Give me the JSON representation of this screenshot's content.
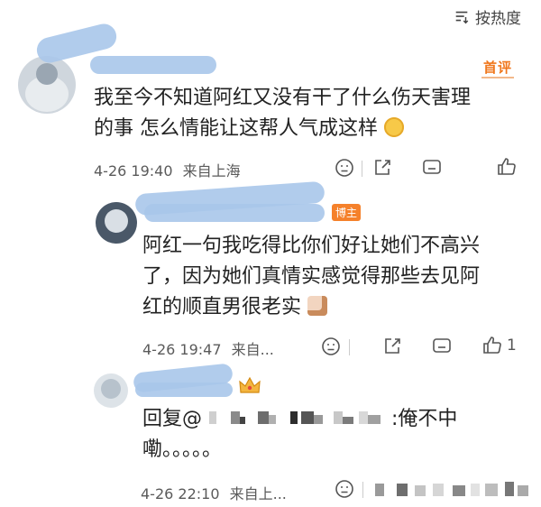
{
  "header": {
    "sort_label": "按热度"
  },
  "comments": [
    {
      "badge": "首评",
      "text_lines": [
        "我至今不知道阿红又没有干了什么伤天害理",
        "的事 怎么情能让这帮人气成这样"
      ],
      "timestamp": "4-26 19:40",
      "location": "来自上海"
    },
    {
      "badge": "博主",
      "text_lines": [
        "阿红一句我吃得比你们好让她们不高兴",
        "了，因为她们真情实感觉得那些去见阿",
        "红的顺直男很老实"
      ],
      "timestamp": "4-26 19:47",
      "location": "来自...",
      "like_count": "1"
    },
    {
      "text_prefix": "回复@",
      "text_suffix": ":俺不中",
      "text_line2": "嘞。。。。。",
      "timestamp": "4-26 22:10",
      "location": "来自上..."
    }
  ],
  "icons": [
    "sort-icon",
    "emoji-icon",
    "share-icon",
    "comment-icon",
    "like-icon",
    "crown-icon"
  ],
  "colors": {
    "badge_first": "#f0771c",
    "badge_owner": "#f5812b",
    "redaction": "#a9c7ea"
  }
}
